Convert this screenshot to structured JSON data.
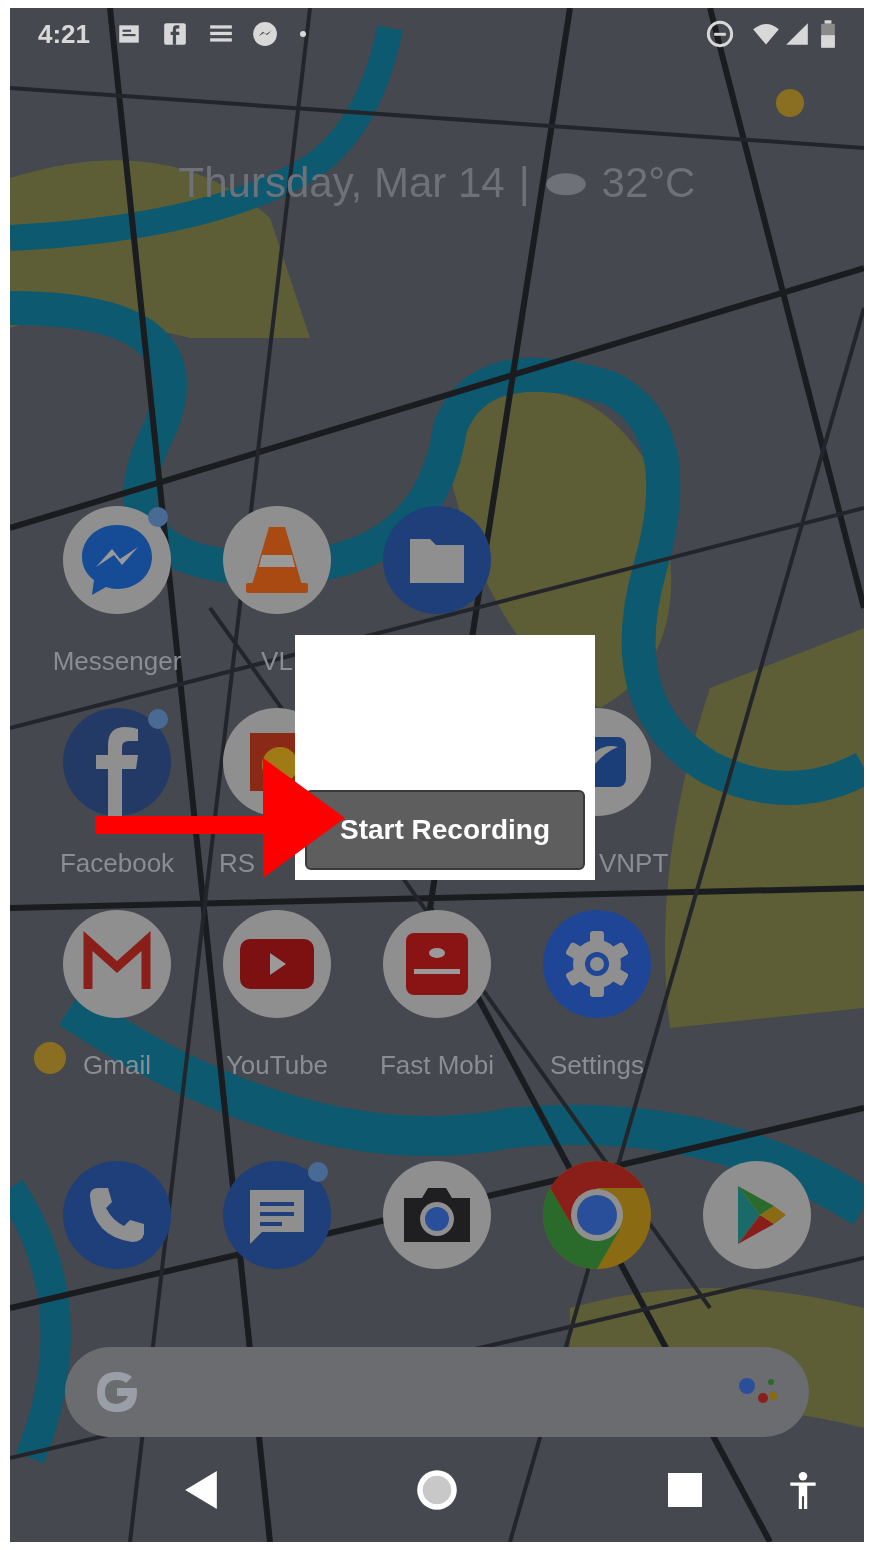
{
  "status_bar": {
    "time": "4:21"
  },
  "date_line": {
    "date": "Thursday, Mar 14",
    "separator": "|",
    "temperature": "32°C"
  },
  "app_rows": [
    [
      {
        "kind": "messenger",
        "label": "Messenger",
        "notification_dot": true
      },
      {
        "kind": "vlc",
        "label": "VL",
        "notification_dot": false
      },
      {
        "kind": "files",
        "notification_dot": false
      },
      {
        "kind": "empty"
      }
    ],
    [
      {
        "kind": "facebook",
        "label": "Facebook",
        "notification_dot": true
      },
      {
        "kind": "rsm",
        "label": "RS",
        "notification_dot": false
      },
      {
        "kind": "empty"
      },
      {
        "kind": "vnpt",
        "label": "VNPT",
        "notification_dot": false
      }
    ],
    [
      {
        "kind": "gmail",
        "label": "Gmail",
        "notification_dot": false
      },
      {
        "kind": "youtube",
        "label": "YouTube",
        "notification_dot": false
      },
      {
        "kind": "fastmobi",
        "label": "Fast Mobi",
        "notification_dot": false
      },
      {
        "kind": "settings",
        "label": "Settings",
        "notification_dot": false
      }
    ]
  ],
  "dock": [
    {
      "kind": "phone",
      "notification_dot": false
    },
    {
      "kind": "messages",
      "notification_dot": true
    },
    {
      "kind": "camera",
      "notification_dot": false
    },
    {
      "kind": "chrome",
      "notification_dot": false
    },
    {
      "kind": "play",
      "notification_dot": false
    }
  ],
  "popup": {
    "button": "Start Recording"
  }
}
